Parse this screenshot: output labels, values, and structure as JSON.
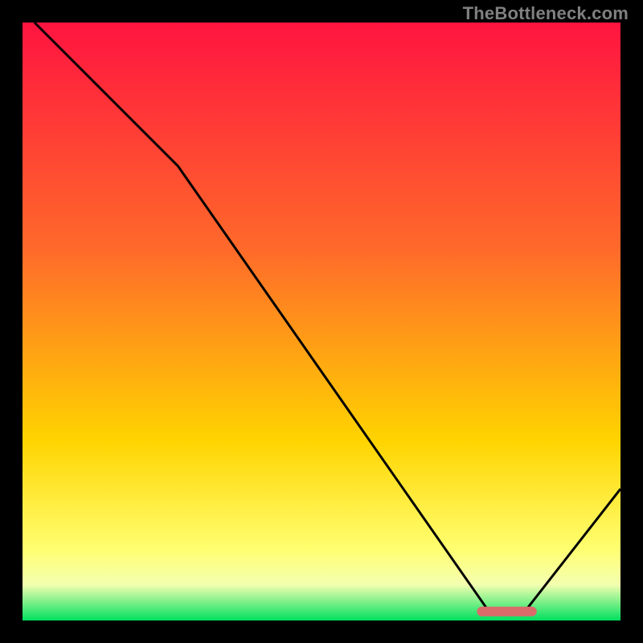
{
  "watermark": "TheBottleneck.com",
  "colors": {
    "black": "#000000",
    "curve": "#000000",
    "marker": "#d96b6b",
    "grad_top": "#ff1440",
    "grad_mid1": "#ff6a2a",
    "grad_mid2": "#ffd400",
    "grad_low1": "#ffff70",
    "grad_low2": "#f4ffb0",
    "grad_green": "#00e060"
  },
  "chart_data": {
    "type": "line",
    "title": "",
    "xlabel": "",
    "ylabel": "",
    "xlim": [
      0,
      100
    ],
    "ylim": [
      0,
      100
    ],
    "x": [
      2,
      26,
      78,
      84,
      100
    ],
    "y": [
      100,
      76,
      1.5,
      1.5,
      22
    ],
    "marker": {
      "x_start": 76,
      "x_end": 86,
      "y": 1.5
    },
    "gradient_stops": [
      {
        "offset": 0,
        "color_key": "grad_top"
      },
      {
        "offset": 38,
        "color_key": "grad_mid1"
      },
      {
        "offset": 70,
        "color_key": "grad_mid2"
      },
      {
        "offset": 88,
        "color_key": "grad_low1"
      },
      {
        "offset": 94,
        "color_key": "grad_low2"
      },
      {
        "offset": 100,
        "color_key": "grad_green"
      }
    ]
  }
}
